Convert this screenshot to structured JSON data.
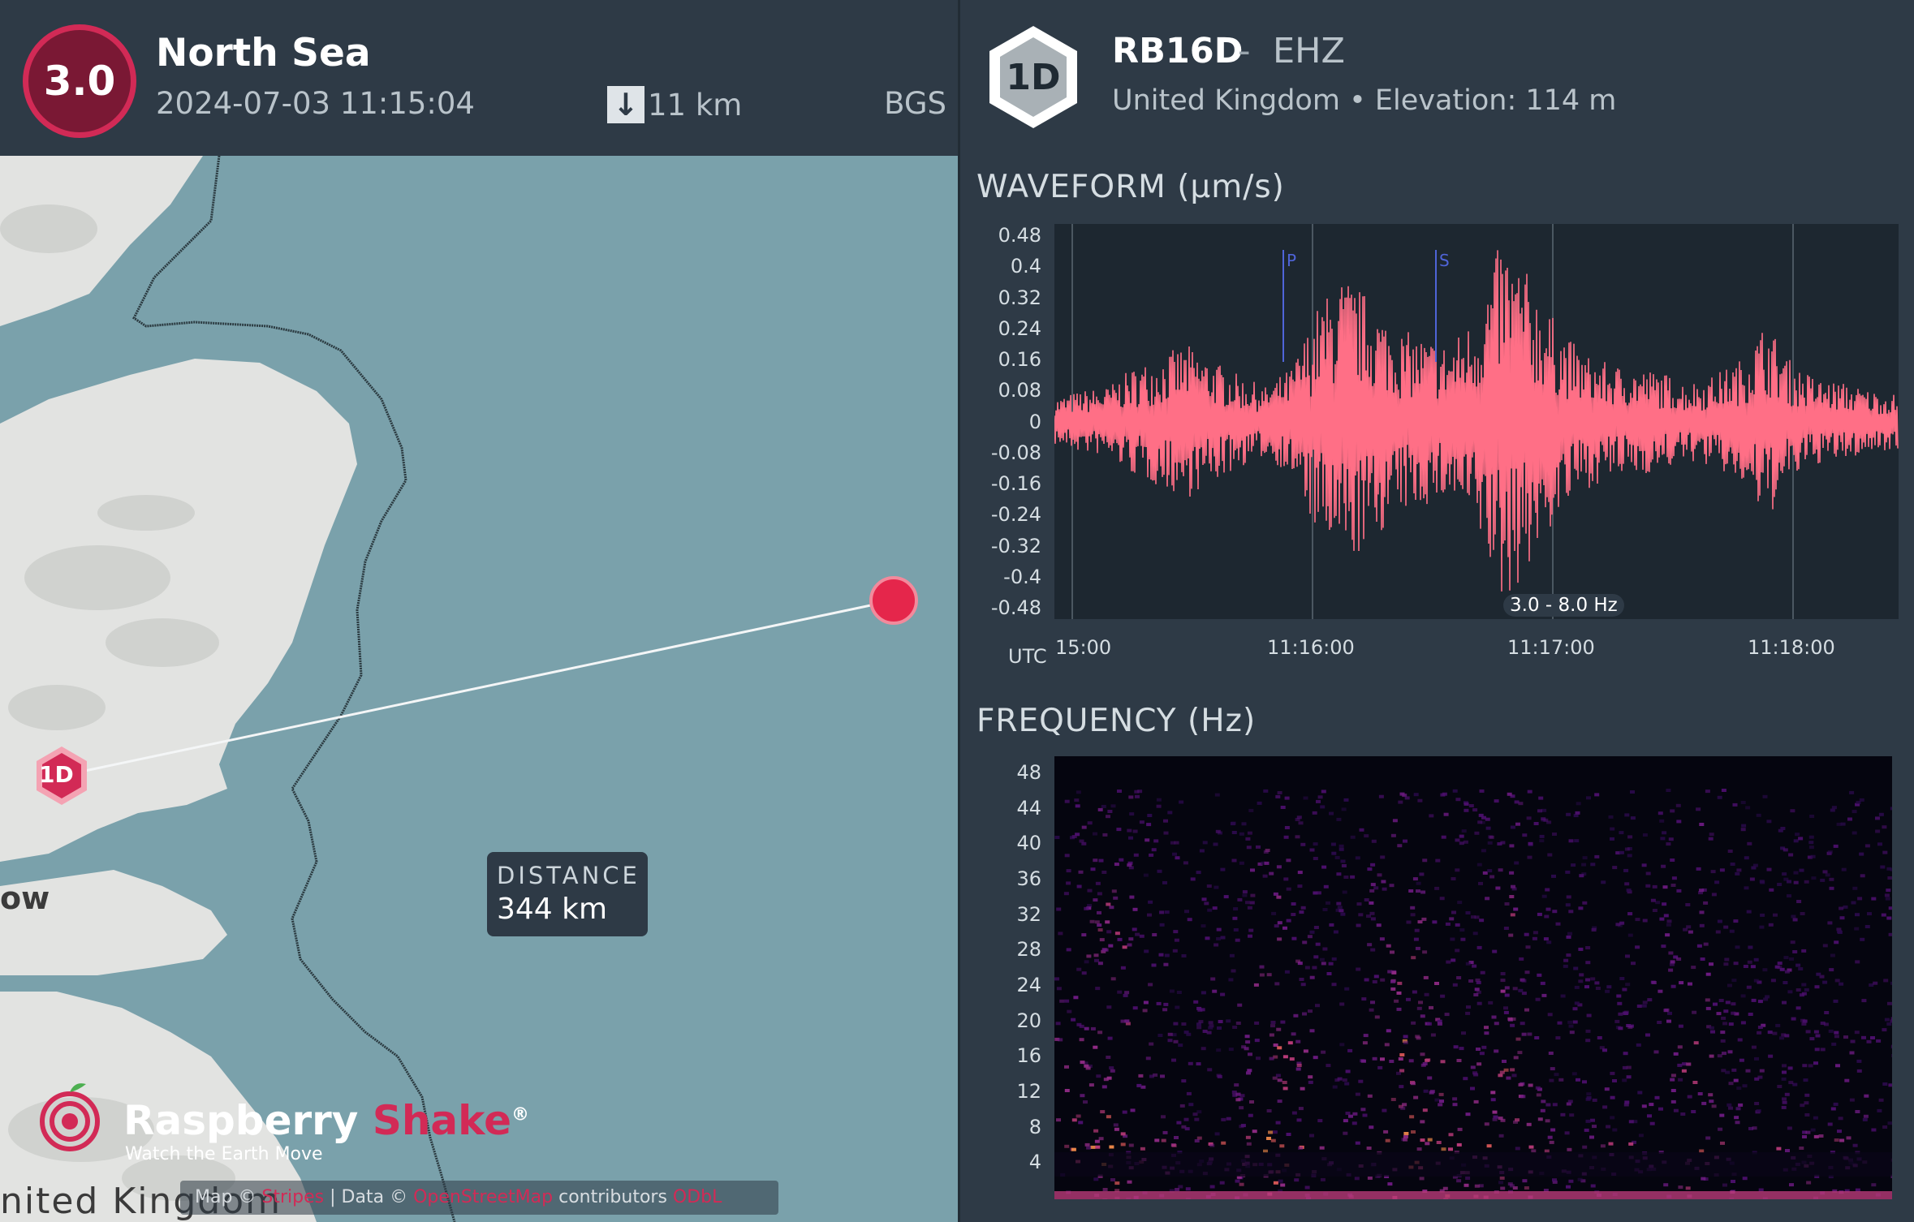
{
  "event": {
    "magnitude": "3.0",
    "region": "North Sea",
    "datetime": "2024-07-03 11:15:04",
    "depth_icon": "arrow-down-icon",
    "depth": "11 km",
    "agency": "BGS"
  },
  "map": {
    "distance_label": "DISTANCE",
    "distance_value": "344 km",
    "station_marker": "1D",
    "town_label": "ow",
    "country_label": "nited Kingdom",
    "brand_name_1": "Raspberry",
    "brand_name_2": "Shake",
    "brand_reg": "®",
    "brand_tagline": "Watch the Earth Move",
    "attribution": {
      "map_prefix": "Map ©",
      "map_link": "Stripes",
      "data_prefix": "| Data ©",
      "data_link": "OpenStreetMap",
      "contributors": "contributors",
      "license_link": "ODbL"
    },
    "colors": {
      "sea": "#7aa1ab",
      "land": "#e2e3e1",
      "epicenter": "#e5264b",
      "station": "#d22a56"
    }
  },
  "station": {
    "code": "1D",
    "name": "RB16D",
    "separator": "-",
    "channel": "EHZ",
    "country": "United Kingdom",
    "bullet": "•",
    "elevation": "Elevation: 114 m"
  },
  "waveform": {
    "title": "WAVEFORM (µm/s)",
    "filter": "3.0 - 8.0 Hz",
    "p_label": "P",
    "s_label": "S",
    "tz_label": "UTC",
    "x_labels": [
      "15:00",
      "11:16:00",
      "11:17:00",
      "11:18:00"
    ],
    "y_labels": [
      "0.48",
      "0.4",
      "0.32",
      "0.24",
      "0.16",
      "0.08",
      "0",
      "-0.08",
      "-0.16",
      "-0.24",
      "-0.32",
      "-0.4",
      "-0.48"
    ],
    "trace_color": "#ff6f86"
  },
  "frequency": {
    "title": "FREQUENCY (Hz)",
    "y_labels": [
      "48",
      "44",
      "40",
      "36",
      "32",
      "28",
      "24",
      "20",
      "16",
      "12",
      "8",
      "4"
    ]
  },
  "chart_data": [
    {
      "type": "line",
      "title": "WAVEFORM (µm/s)",
      "ylim": [
        -0.48,
        0.48
      ],
      "x_ticks": [
        "15:00",
        "11:16:00",
        "11:17:00",
        "11:18:00"
      ],
      "series": [
        {
          "name": "",
          "values_envelope_abs": [
            0.06,
            0.08,
            0.09,
            0.14,
            0.17,
            0.2,
            0.16,
            0.12,
            0.09,
            0.14,
            0.3,
            0.38,
            0.32,
            0.24,
            0.22,
            0.2,
            0.28,
            0.48,
            0.38,
            0.26,
            0.18,
            0.15,
            0.14,
            0.13,
            0.1,
            0.12,
            0.16,
            0.26,
            0.15,
            0.11,
            0.1,
            0.08,
            0.07
          ]
        }
      ],
      "markers": [
        {
          "label": "P",
          "time": "11:15:50"
        },
        {
          "label": "S",
          "time": "11:16:33"
        }
      ]
    },
    {
      "type": "heatmap",
      "title": "FREQUENCY (Hz)",
      "ylim": [
        0,
        50
      ],
      "y_ticks": [
        48,
        44,
        40,
        36,
        32,
        28,
        24,
        20,
        16,
        12,
        8,
        4
      ]
    }
  ]
}
